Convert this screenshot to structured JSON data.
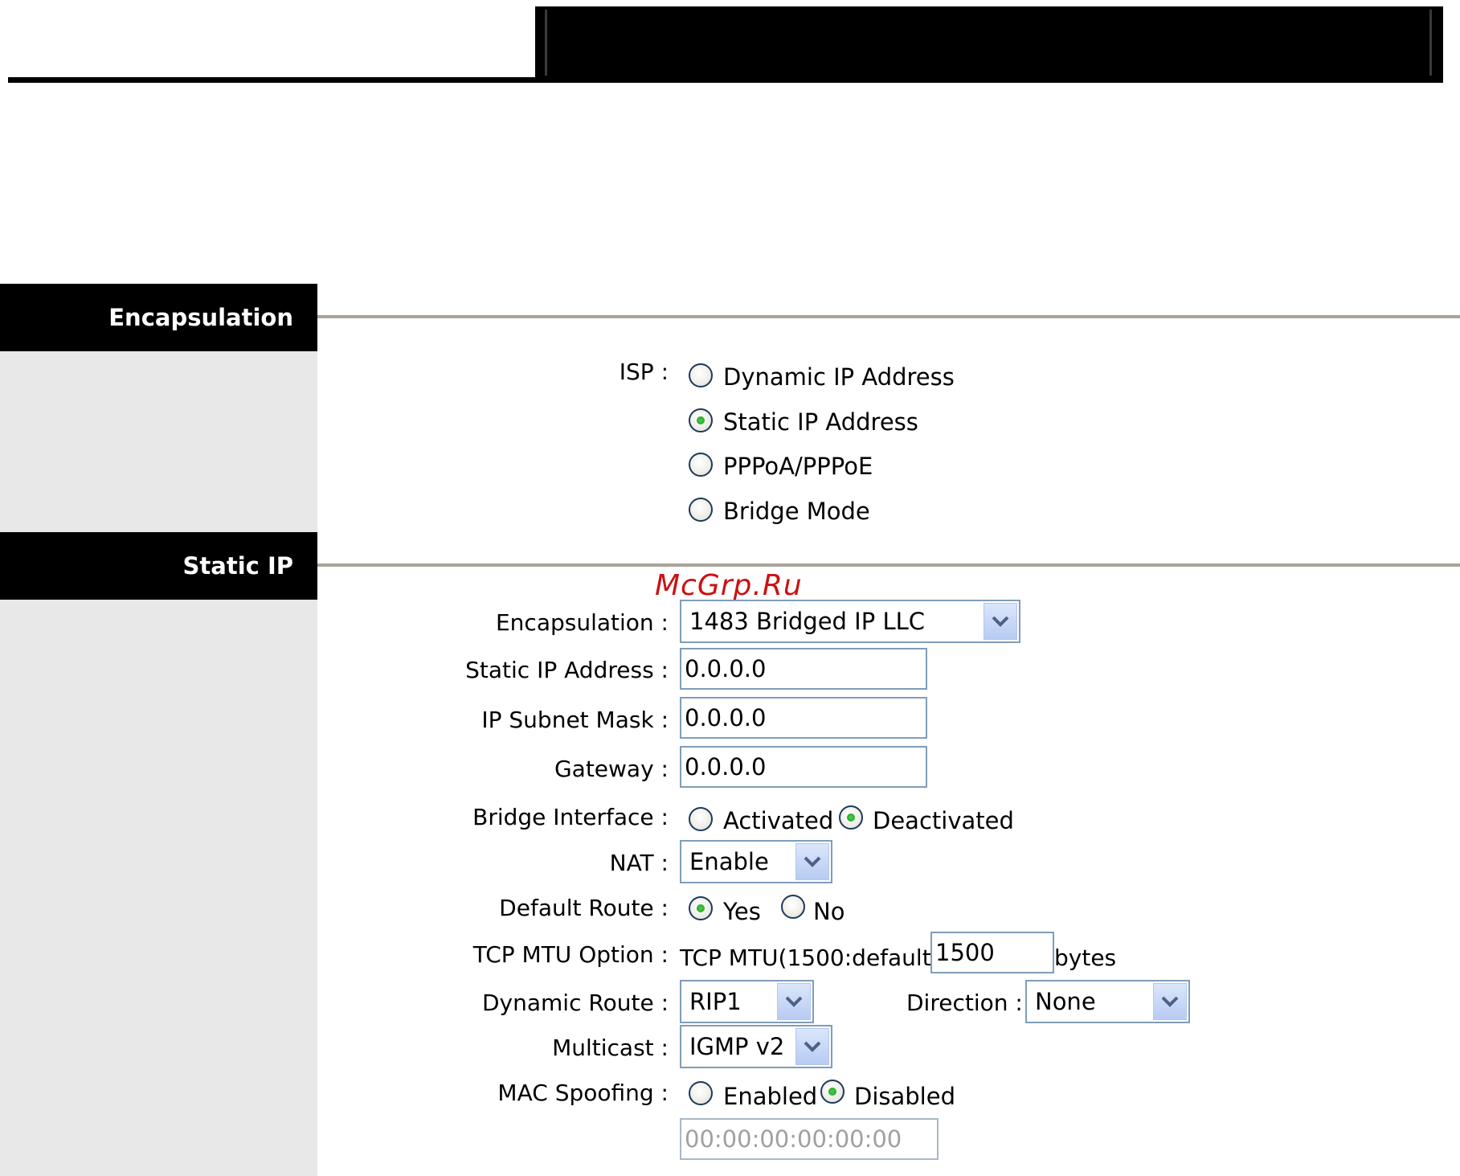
{
  "encapsulation_section": {
    "heading": "Encapsulation",
    "isp_label": "ISP :",
    "isp_options": [
      {
        "label": "Dynamic IP Address",
        "selected": false
      },
      {
        "label": "Static IP Address",
        "selected": true
      },
      {
        "label": "PPPoA/PPPoE",
        "selected": false
      },
      {
        "label": "Bridge Mode",
        "selected": false
      }
    ]
  },
  "static_ip_section": {
    "heading": "Static IP",
    "encapsulation": {
      "label": "Encapsulation :",
      "value": "1483 Bridged IP LLC"
    },
    "static_ip_address": {
      "label": "Static IP Address :",
      "value": "0.0.0.0"
    },
    "ip_subnet_mask": {
      "label": "IP Subnet Mask :",
      "value": "0.0.0.0"
    },
    "gateway": {
      "label": "Gateway :",
      "value": "0.0.0.0"
    },
    "bridge_interface": {
      "label": "Bridge Interface :",
      "options": [
        {
          "label": "Activated",
          "selected": false
        },
        {
          "label": "Deactivated",
          "selected": true
        }
      ]
    },
    "nat": {
      "label": "NAT :",
      "value": "Enable"
    },
    "default_route": {
      "label": "Default Route :",
      "options": [
        {
          "label": "Yes",
          "selected": true
        },
        {
          "label": "No",
          "selected": false
        }
      ]
    },
    "tcp_mtu": {
      "label": "TCP MTU Option :",
      "prefix": "TCP MTU(1500:default)",
      "value": "1500",
      "suffix": "bytes"
    },
    "dynamic_route": {
      "label": "Dynamic Route :",
      "value": "RIP1"
    },
    "direction": {
      "label": "Direction :",
      "value": "None"
    },
    "multicast": {
      "label": "Multicast :",
      "value": "IGMP v2"
    },
    "mac_spoofing": {
      "label": "MAC Spoofing :",
      "options": [
        {
          "label": "Enabled",
          "selected": false
        },
        {
          "label": "Disabled",
          "selected": true
        }
      ],
      "mac_value": "00:00:00:00:00:00"
    }
  },
  "watermark": "McGrp.Ru",
  "colors": {
    "section_header_bg": "#000000",
    "sidebar_bg": "#e8e8e8",
    "section_rule": "#a8a49a",
    "input_border": "#7f9db9",
    "radio_dot": "#1c9a1c",
    "select_arrow": "#4d6185",
    "watermark": "#cc1111"
  },
  "icons": {
    "select_arrow": "chevron-down-icon",
    "radio_selected_dot": "radio-dot-icon"
  }
}
